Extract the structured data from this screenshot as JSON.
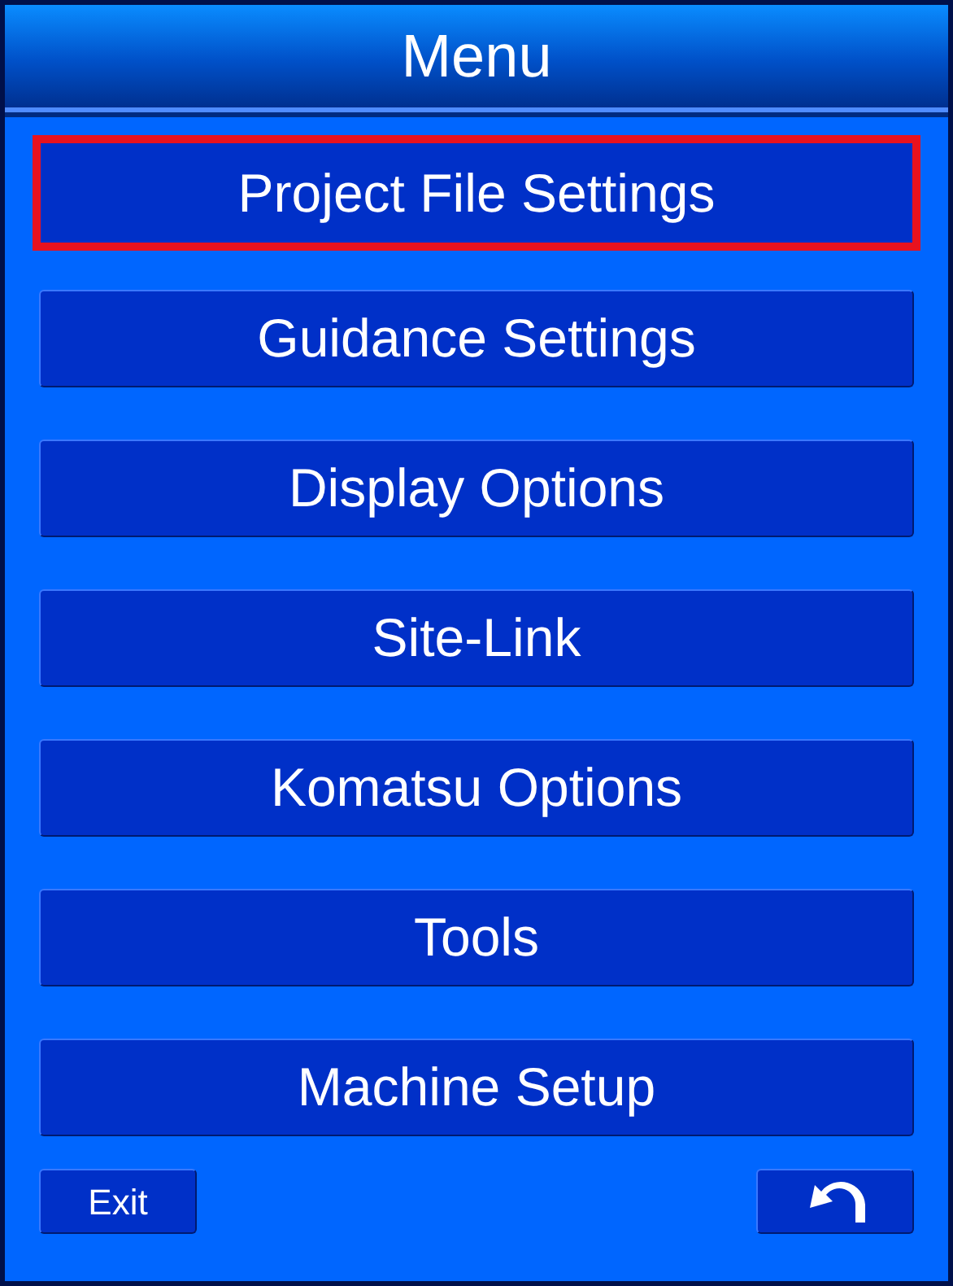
{
  "window": {
    "title": "Menu"
  },
  "menu_items": [
    {
      "label": "Project File Settings",
      "selected": true
    },
    {
      "label": "Guidance Settings",
      "selected": false
    },
    {
      "label": "Display Options",
      "selected": false
    },
    {
      "label": "Site-Link",
      "selected": false
    },
    {
      "label": "Komatsu Options",
      "selected": false
    },
    {
      "label": "Tools",
      "selected": false
    },
    {
      "label": "Machine Setup",
      "selected": false
    }
  ],
  "footer": {
    "exit_button": "Exit"
  }
}
